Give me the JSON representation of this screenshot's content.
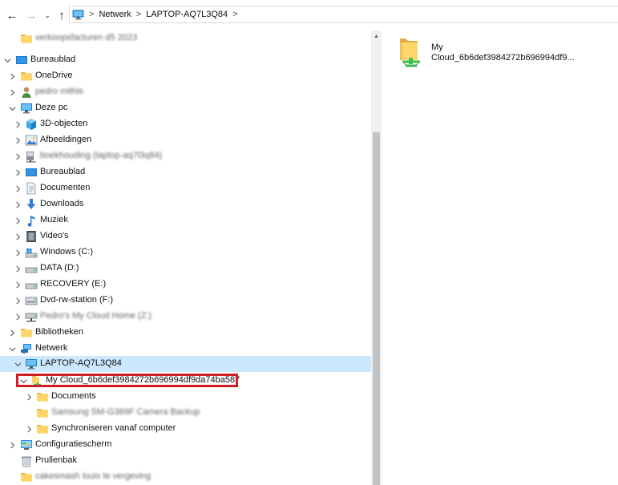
{
  "toolbar": {
    "back_glyph": "←",
    "forward_glyph": "→",
    "recent_glyph": "⌄",
    "up_glyph": "↑"
  },
  "breadcrumb": {
    "items": [
      "Netwerk",
      "LAPTOP-AQ7L3Q84"
    ],
    "separator": ">"
  },
  "nav": {
    "items": [
      {
        "label": "verkoopsfacturen d5 2023",
        "icon": "folder-icon",
        "blurred": true
      },
      {
        "label": "Bureaublad",
        "icon": "desktop-icon",
        "expanded": true
      },
      {
        "label": "OneDrive",
        "icon": "folder-icon"
      },
      {
        "label": "pedro mithis",
        "icon": "user-icon",
        "blurred": true
      },
      {
        "label": "Deze pc",
        "icon": "pc-icon",
        "expanded": true
      },
      {
        "label": "3D-objecten",
        "icon": "3d-objects-icon"
      },
      {
        "label": "Afbeeldingen",
        "icon": "pictures-icon"
      },
      {
        "label": "boekhouding (laptop-aq7l3q84)",
        "icon": "network-drive-icon",
        "blurred": true
      },
      {
        "label": "Bureaublad",
        "icon": "desktop-icon"
      },
      {
        "label": "Documenten",
        "icon": "documents-icon"
      },
      {
        "label": "Downloads",
        "icon": "downloads-icon"
      },
      {
        "label": "Muziek",
        "icon": "music-icon"
      },
      {
        "label": "Video's",
        "icon": "videos-icon"
      },
      {
        "label": "Windows (C:)",
        "icon": "windows-drive-icon"
      },
      {
        "label": "DATA (D:)",
        "icon": "drive-icon"
      },
      {
        "label": "RECOVERY (E:)",
        "icon": "drive-icon"
      },
      {
        "label": "Dvd-rw-station (F:)",
        "icon": "dvd-drive-icon"
      },
      {
        "label": "Pedro's My Cloud Home (Z:)",
        "icon": "network-drive-icon",
        "blurred": true
      },
      {
        "label": "Bibliotheken",
        "icon": "folder-icon"
      },
      {
        "label": "Netwerk",
        "icon": "network-icon",
        "expanded": true
      },
      {
        "label": "LAPTOP-AQ7L3Q84",
        "icon": "pc-icon",
        "expanded": true,
        "selected": true
      },
      {
        "label": "My Cloud_6b6def3984272b696994df9da74ba587",
        "icon": "shared-folder-icon",
        "expanded": true
      },
      {
        "label": "Documents",
        "icon": "folder-icon"
      },
      {
        "label": "Samsung SM-G389F Camera Backup",
        "icon": "folder-icon",
        "blurred": true
      },
      {
        "label": "Synchroniseren vanaf computer",
        "icon": "folder-icon"
      },
      {
        "label": "Configuratiescherm",
        "icon": "control-panel-icon"
      },
      {
        "label": "Prullenbak",
        "icon": "recycle-bin-icon"
      },
      {
        "label": "cakesmash louis te vergeving",
        "icon": "folder-icon",
        "blurred": true
      }
    ]
  },
  "content": {
    "tile": {
      "line1": "My",
      "line2": "Cloud_6b6def3984272b696994df9...",
      "icon": "shared-folder-icon"
    }
  },
  "highlight": {
    "color": "#d01c24"
  }
}
